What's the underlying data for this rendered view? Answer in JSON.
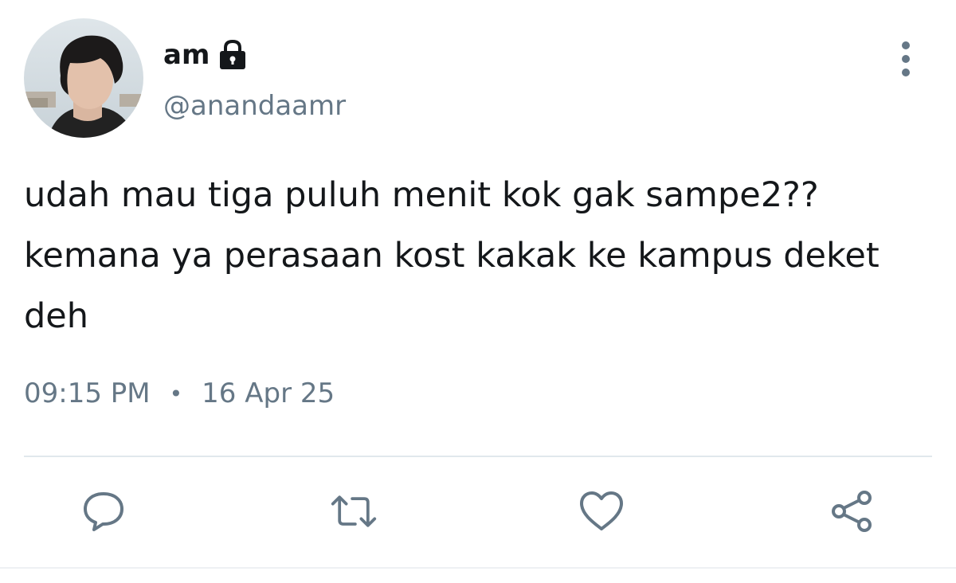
{
  "user": {
    "display_name": "am",
    "handle": "@anandaamr",
    "avatar_icon": "profile-photo",
    "protected_icon": "lock-icon"
  },
  "tweet": {
    "text": "udah mau tiga puluh menit kok gak sampe2??\nkemana ya perasaan kost kakak ke kampus deket\ndeh",
    "time": "09:15 PM",
    "separator": "•",
    "date": "16 Apr 25"
  },
  "actions": [
    {
      "name": "reply",
      "icon": "speech-bubble-icon"
    },
    {
      "name": "retweet",
      "icon": "retweet-icon"
    },
    {
      "name": "like",
      "icon": "heart-icon"
    },
    {
      "name": "share",
      "icon": "share-icon"
    }
  ],
  "colors": {
    "text": "#14171a",
    "secondary": "#657786",
    "divider": "#e1e8ed"
  }
}
